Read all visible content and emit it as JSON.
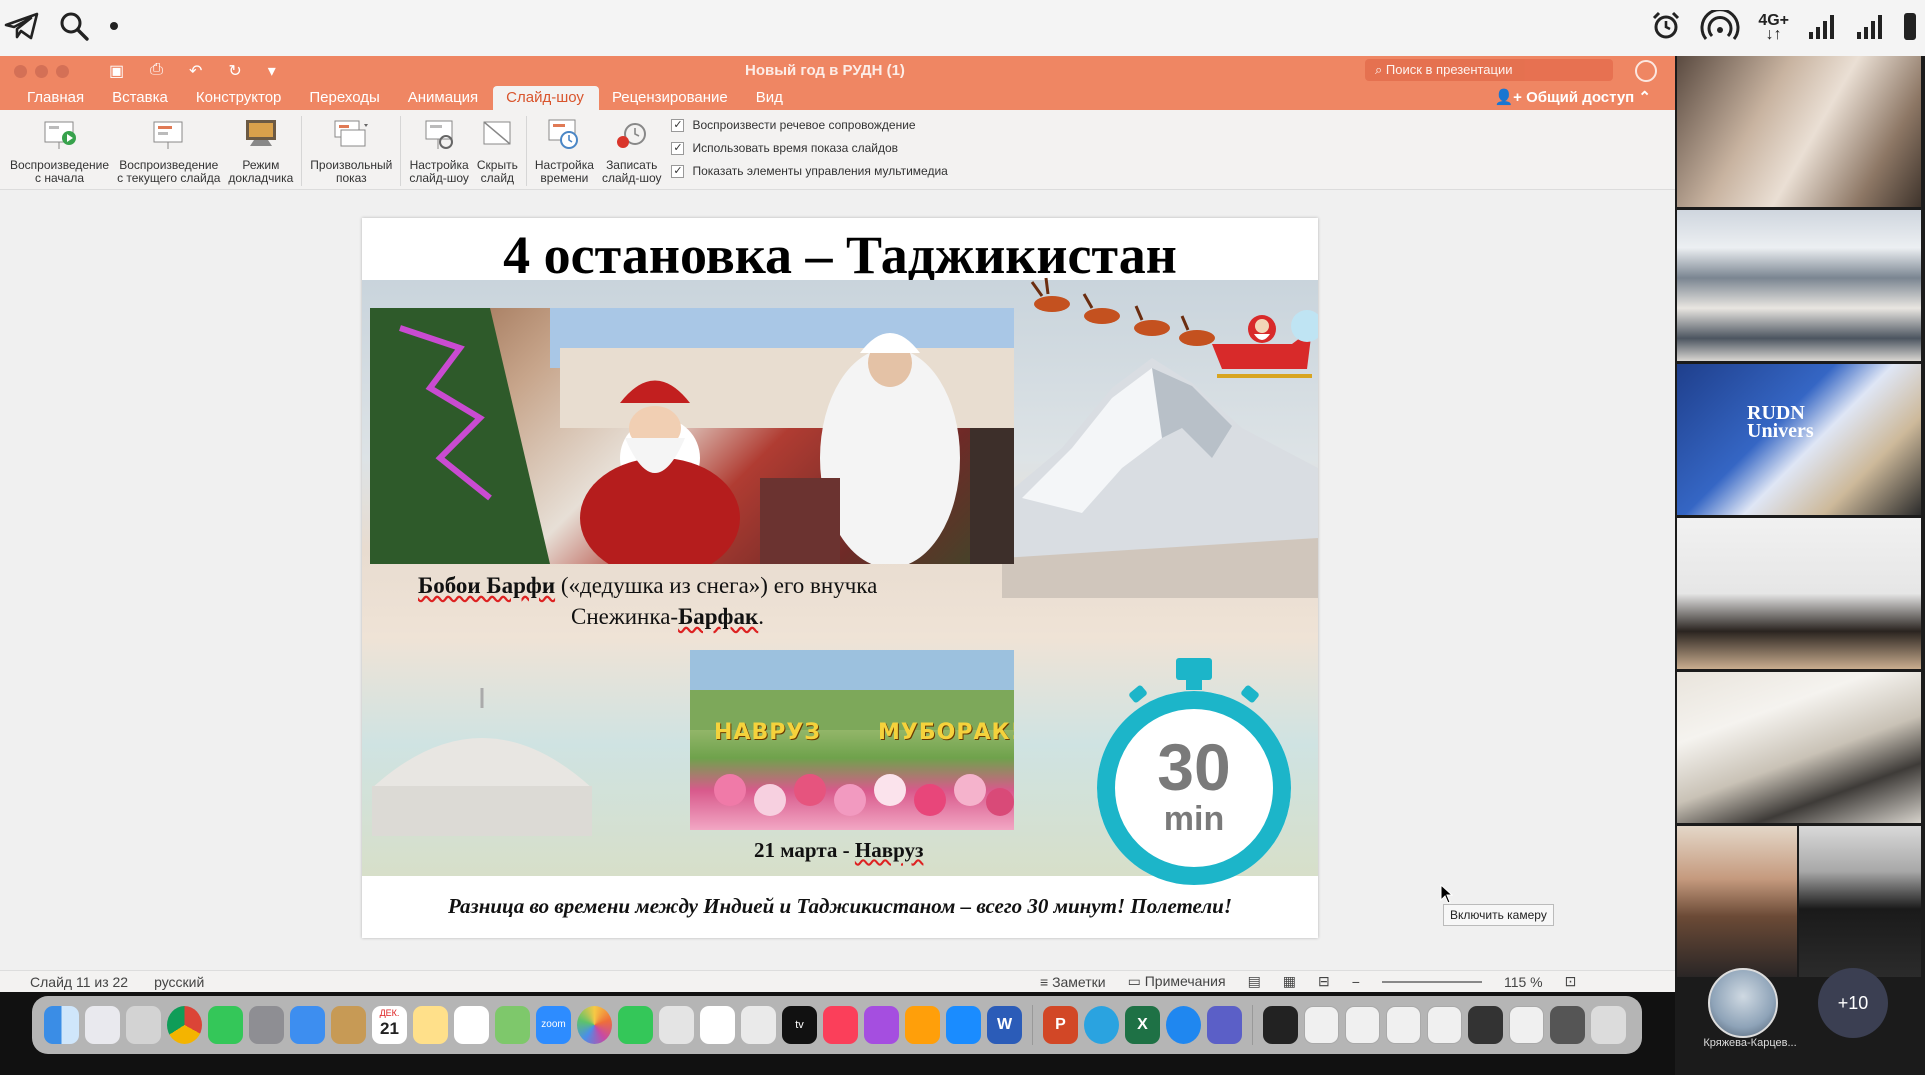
{
  "statusbar": {
    "left_icons": [
      "telegram-icon",
      "search-icon",
      "dot-icon"
    ],
    "right_icons": [
      "alarm-icon",
      "hotspot-icon",
      "signal-icon",
      "signal-icon",
      "battery-icon"
    ],
    "network_top": "4G+",
    "network_bottom": "↓↑"
  },
  "window": {
    "title": "Новый год в РУДН (1)",
    "search_placeholder": "Поиск в презентации"
  },
  "ribbon_tabs": [
    {
      "label": "Главная"
    },
    {
      "label": "Вставка"
    },
    {
      "label": "Конструктор"
    },
    {
      "label": "Переходы"
    },
    {
      "label": "Анимация"
    },
    {
      "label": "Слайд-шоу",
      "active": true
    },
    {
      "label": "Рецензирование"
    },
    {
      "label": "Вид"
    }
  ],
  "share_label": "Общий доступ",
  "ribbon": {
    "btn_from_start_1": "Воспроизведение",
    "btn_from_start_2": "с начала",
    "btn_from_current_1": "Воспроизведение",
    "btn_from_current_2": "с текущего слайда",
    "btn_presenter_1": "Режим",
    "btn_presenter_2": "докладчика",
    "btn_custom_1": "Произвольный",
    "btn_custom_2": "показ",
    "btn_setup_1": "Настройка",
    "btn_setup_2": "слайд-шоу",
    "btn_hide_1": "Скрыть",
    "btn_hide_2": "слайд",
    "btn_timing_1": "Настройка",
    "btn_timing_2": "времени",
    "btn_record_1": "Записать",
    "btn_record_2": "слайд-шоу",
    "chk_narration": "Воспроизвести речевое сопровождение",
    "chk_timings": "Использовать время показа слайдов",
    "chk_media": "Показать элементы управления мультимедиа"
  },
  "slide": {
    "title": "4 остановка – Таджикистан",
    "caption_bold1": "Бобои Барфи",
    "caption_rest1": " («дедушка из снега») его внучка",
    "caption_line2_a": "Снежинка-",
    "caption_line2_b": "Барфак",
    "caption_line2_c": ".",
    "navruz_left": "НАВРУЗ",
    "navruz_right": "МУБОРАК!",
    "date_caption_a": "21 марта - ",
    "date_caption_b": "Навруз",
    "timer_number": "30",
    "timer_unit": "min",
    "bottom_text": "Разница во времени между Индией и Таджикистаном – всего 30 минут! Полетели!",
    "accent_color": "#1cb5c9"
  },
  "status": {
    "slide_info": "Слайд 11 из 22",
    "language": "русский",
    "notes": "Заметки",
    "comments": "Примечания",
    "zoom": "115 %",
    "tooltip": "Включить камеру"
  },
  "video": {
    "participant_name": "Кряжева-Карцев...",
    "more_count": "+10",
    "tile_overlay_1": "RUDN",
    "tile_overlay_2": "Univers"
  },
  "dock": {
    "calendar_month": "ДЕК.",
    "calendar_day": "21",
    "zoom_label": "zoom",
    "tv_label": "tv",
    "word_label": "W",
    "excel_label": "X",
    "ppt_label": "P"
  }
}
